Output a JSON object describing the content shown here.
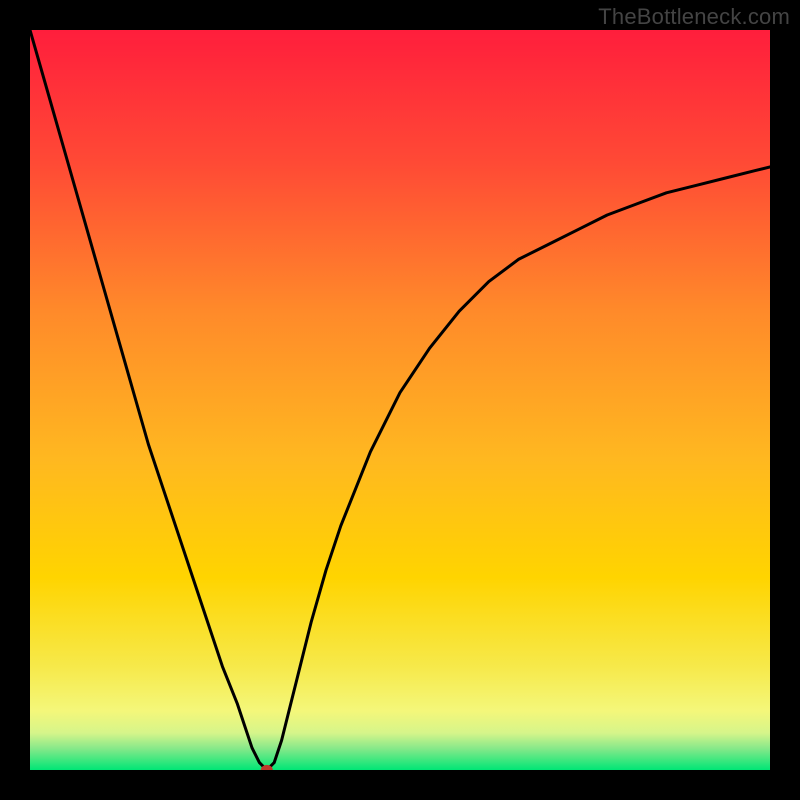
{
  "watermark": "TheBottleneck.com",
  "chart_data": {
    "type": "line",
    "title": "",
    "xlabel": "",
    "ylabel": "",
    "xlim": [
      0,
      100
    ],
    "ylim": [
      0,
      100
    ],
    "grid": false,
    "legend": false,
    "background_gradient": {
      "top_color": "#ff1a3a",
      "mid_color": "#ffd400",
      "bottom_band_start": 93,
      "bottom_band_end": 100,
      "bottom_color": "#00e676"
    },
    "marker": {
      "x": 32,
      "y": 0,
      "color": "#c0392b",
      "radius_px": 6
    },
    "x": [
      0,
      2,
      4,
      6,
      8,
      10,
      12,
      14,
      16,
      18,
      20,
      22,
      24,
      26,
      28,
      29,
      30,
      31,
      32,
      33,
      34,
      35,
      36,
      38,
      40,
      42,
      44,
      46,
      48,
      50,
      54,
      58,
      62,
      66,
      70,
      74,
      78,
      82,
      86,
      90,
      94,
      98,
      100
    ],
    "values": [
      100,
      93,
      86,
      79,
      72,
      65,
      58,
      51,
      44,
      38,
      32,
      26,
      20,
      14,
      9,
      6,
      3,
      1,
      0,
      1,
      4,
      8,
      12,
      20,
      27,
      33,
      38,
      43,
      47,
      51,
      57,
      62,
      66,
      69,
      71,
      73,
      75,
      76.5,
      78,
      79,
      80,
      81,
      81.5
    ],
    "series_stroke": "#000000",
    "series_stroke_width": 3
  }
}
